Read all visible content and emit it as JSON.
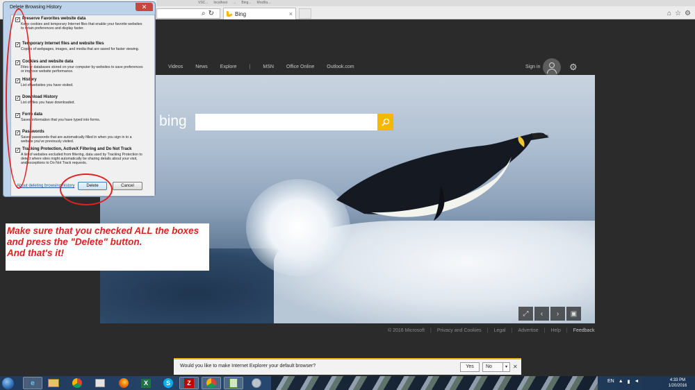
{
  "browser": {
    "strip_tabs": [
      "VSC...",
      "localhost",
      "...",
      "Bing...",
      "Mozilla..."
    ],
    "active_tab_title": "Bing",
    "tab_close": "×",
    "icons": [
      "search-icon",
      "refresh-icon",
      "home-icon",
      "favorites-icon",
      "tools-icon"
    ]
  },
  "bing": {
    "nav": [
      "Videos",
      "News",
      "Explore",
      "|",
      "MSN",
      "Office Online",
      "Outlook.com"
    ],
    "signin": "Sign in",
    "logo_text": "bing",
    "search_value": "",
    "footer": [
      "© 2016 Microsoft",
      "|",
      "Privacy and Cookies",
      "|",
      "Legal",
      "|",
      "Advertise",
      "|",
      "Help",
      "|",
      "Feedback"
    ],
    "hero_controls": [
      "⤢",
      "‹",
      "›",
      "▣"
    ]
  },
  "dialog": {
    "title": "Delete Browsing History",
    "close": "✕",
    "options": [
      {
        "title": "Preserve Favorites website data",
        "desc": "Keep cookies and temporary Internet files that enable your favorite websites to retain preferences and display faster.",
        "checked": true
      },
      {
        "title": "Temporary Internet files and website files",
        "desc": "Copies of webpages, images, and media that are saved for faster viewing.",
        "checked": true
      },
      {
        "title": "Cookies and website data",
        "desc": "Files or databases stored on your computer by websites to save preferences or improve website performance.",
        "checked": true
      },
      {
        "title": "History",
        "desc": "List of websites you have visited.",
        "checked": true
      },
      {
        "title": "Download History",
        "desc": "List of files you have downloaded.",
        "checked": true
      },
      {
        "title": "Form data",
        "desc": "Saved information that you have typed into forms.",
        "checked": true
      },
      {
        "title": "Passwords",
        "desc": "Saved passwords that are automatically filled in when you sign in to a website you've previously visited.",
        "checked": true
      },
      {
        "title": "Tracking Protection, ActiveX Filtering and Do Not Track",
        "desc": "A list of websites excluded from filtering, data used by Tracking Protection to detect where sites might automatically be sharing details about your visit, and exceptions to Do Not Track requests.",
        "checked": true
      }
    ],
    "link": "About deleting browsing history",
    "delete_label": "Delete",
    "cancel_label": "Cancel"
  },
  "annotation": {
    "lines": [
      "Make sure that you checked ALL the boxes",
      "and press the \"Delete\" button.",
      "And that's it!"
    ],
    "color": "#dd2222"
  },
  "notification": {
    "text": "Would you like to make Internet Explorer your default browser?",
    "yes": "Yes",
    "no": "No",
    "dropdown": "▾",
    "close": "✕"
  },
  "taskbar": {
    "apps": [
      "ie-icon",
      "explorer-icon",
      "chrome-icon",
      "media-icon",
      "firefox-icon",
      "excel-icon",
      "skype-icon",
      "filezilla-icon",
      "chrome-icon",
      "notepad-icon",
      "tool-icon"
    ],
    "lang": "EN",
    "time": "4:33 PM",
    "date": "1/20/2016"
  }
}
